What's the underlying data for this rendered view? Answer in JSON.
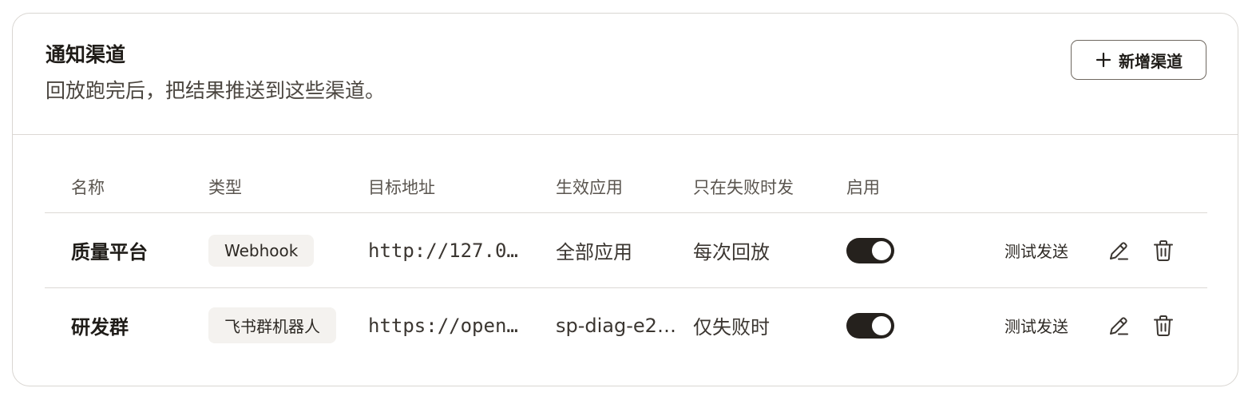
{
  "panel": {
    "title": "通知渠道",
    "subtitle": "回放跑完后，把结果推送到这些渠道。",
    "add_button_label": "新增渠道"
  },
  "table": {
    "columns": [
      "名称",
      "类型",
      "目标地址",
      "生效应用",
      "只在失败时发",
      "启用"
    ],
    "rows": [
      {
        "name": "质量平台",
        "type": "Webhook",
        "target": "http://127.0…",
        "apps": "全部应用",
        "fail_only": "每次回放",
        "enabled": true,
        "test_label": "测试发送"
      },
      {
        "name": "研发群",
        "type": "飞书群机器人",
        "target": "https://open…",
        "apps": "sp-diag-e2…",
        "fail_only": "仅失败时",
        "enabled": true,
        "test_label": "测试发送"
      }
    ]
  },
  "icons": {
    "add": "plus-icon",
    "edit": "pencil-icon",
    "delete": "trash-icon"
  },
  "colors": {
    "toggle_on": "#25211d",
    "badge_bg": "#f4f2ef",
    "border": "#d9d6d2"
  }
}
